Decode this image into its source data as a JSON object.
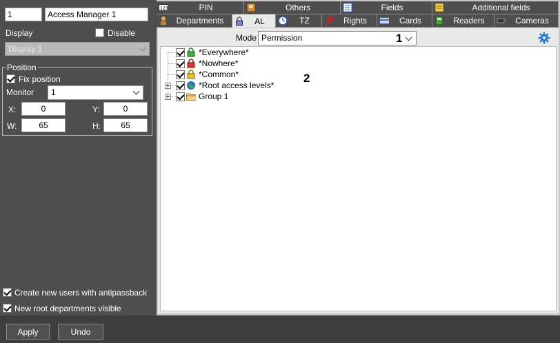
{
  "left": {
    "id_value": "1",
    "name_value": "Access Manager 1",
    "display_label": "Display",
    "disable_label": "Disable",
    "display_select": "Display 1",
    "position": {
      "title": "Position",
      "fix_label": "Fix position",
      "monitor_label": "Monitor",
      "monitor_value": "1",
      "x_label": "X:",
      "x_value": "0",
      "y_label": "Y:",
      "y_value": "0",
      "w_label": "W:",
      "w_value": "65",
      "h_label": "H:",
      "h_value": "65"
    },
    "antipassback_label": "Create new users with antipassback",
    "root_visible_label": "New root departments visible"
  },
  "tabs": {
    "row1": [
      {
        "label": "PIN",
        "icon": "pin-icon"
      },
      {
        "label": "Others",
        "icon": "others-icon"
      },
      {
        "label": "Fields",
        "icon": "fields-icon"
      },
      {
        "label": "Additional fields",
        "icon": "additional-fields-icon"
      }
    ],
    "row2": [
      {
        "label": "Departments",
        "icon": "departments-icon"
      },
      {
        "label": "AL",
        "icon": "lock-icon"
      },
      {
        "label": "TZ",
        "icon": "clock-icon"
      },
      {
        "label": "Rights",
        "icon": "rights-icon"
      },
      {
        "label": "Cards",
        "icon": "card-icon"
      },
      {
        "label": "Readers",
        "icon": "reader-icon"
      },
      {
        "label": "Cameras",
        "icon": "camera-icon"
      }
    ]
  },
  "main": {
    "mode_label": "Mode",
    "mode_value": "Permission",
    "marker1": "1",
    "marker2": "2",
    "tree": [
      {
        "label": "*Everywhere*",
        "icon": "green-lock-icon"
      },
      {
        "label": "*Nowhere*",
        "icon": "red-lock-icon"
      },
      {
        "label": "*Common*",
        "icon": "yellow-lock-icon"
      },
      {
        "label": "*Root access levels*",
        "icon": "globe-icon"
      },
      {
        "label": "Group 1",
        "icon": "folder-icon"
      }
    ]
  },
  "buttons": {
    "apply": "Apply",
    "undo": "Undo"
  },
  "colors": {
    "panel_bg": "#4e4e4e",
    "content_bg": "#e9e9e9",
    "accent_blue": "#2a7bd8"
  }
}
